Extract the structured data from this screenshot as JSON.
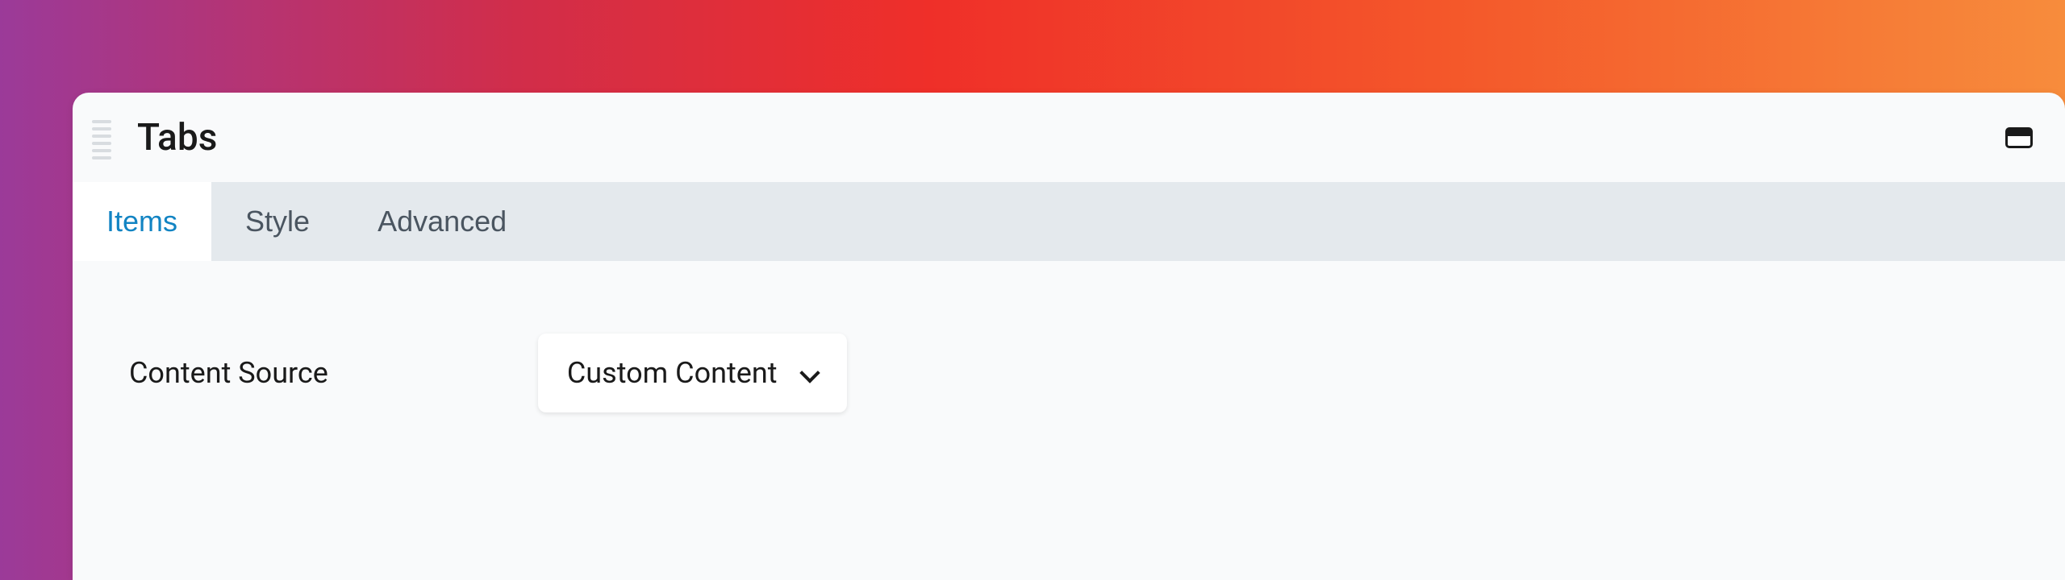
{
  "panel": {
    "title": "Tabs"
  },
  "tabs": [
    {
      "label": "Items",
      "active": true
    },
    {
      "label": "Style",
      "active": false
    },
    {
      "label": "Advanced",
      "active": false
    }
  ],
  "content": {
    "source_label": "Content Source",
    "source_value": "Custom Content"
  }
}
